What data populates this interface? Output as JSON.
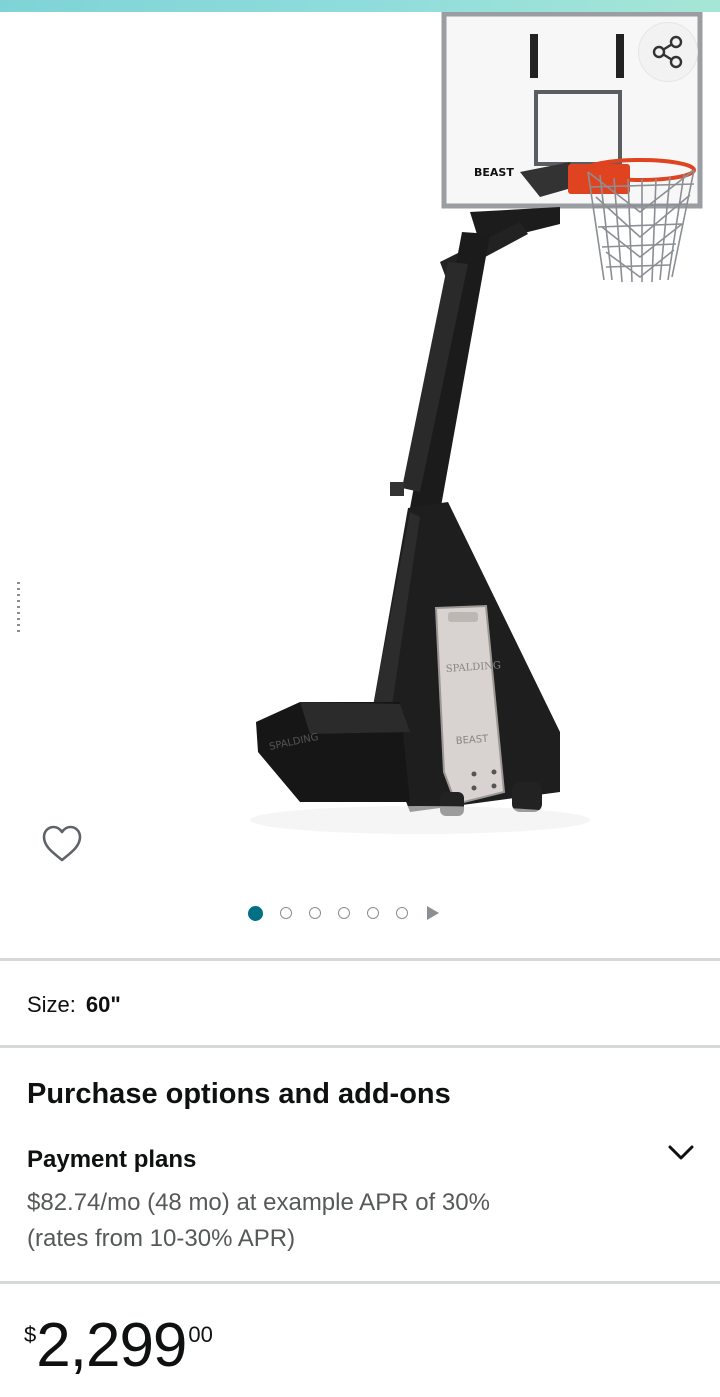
{
  "gallery": {
    "image_alt": "Spalding The Beast portable basketball hoop",
    "image_count": 6,
    "active_index": 0,
    "backboard_brand": "BEAST",
    "base_brand": "SPALDING",
    "base_label": "BEAST",
    "icons": {
      "share": "share-icon",
      "wishlist": "heart-icon",
      "next": "play-icon"
    }
  },
  "size": {
    "label": "Size:",
    "value": "60\""
  },
  "purchase_options": {
    "title": "Purchase options and add-ons",
    "payment_plans": {
      "title": "Payment plans",
      "line1": "$82.74/mo (48 mo) at example APR of 30%",
      "line2": "(rates from 10-30% APR)"
    }
  },
  "price": {
    "symbol": "$",
    "whole": "2,299",
    "fraction": "00"
  },
  "colors": {
    "accent": "#007185",
    "rim": "#e0431f",
    "text": "#0f1111",
    "muted": "#565959"
  }
}
